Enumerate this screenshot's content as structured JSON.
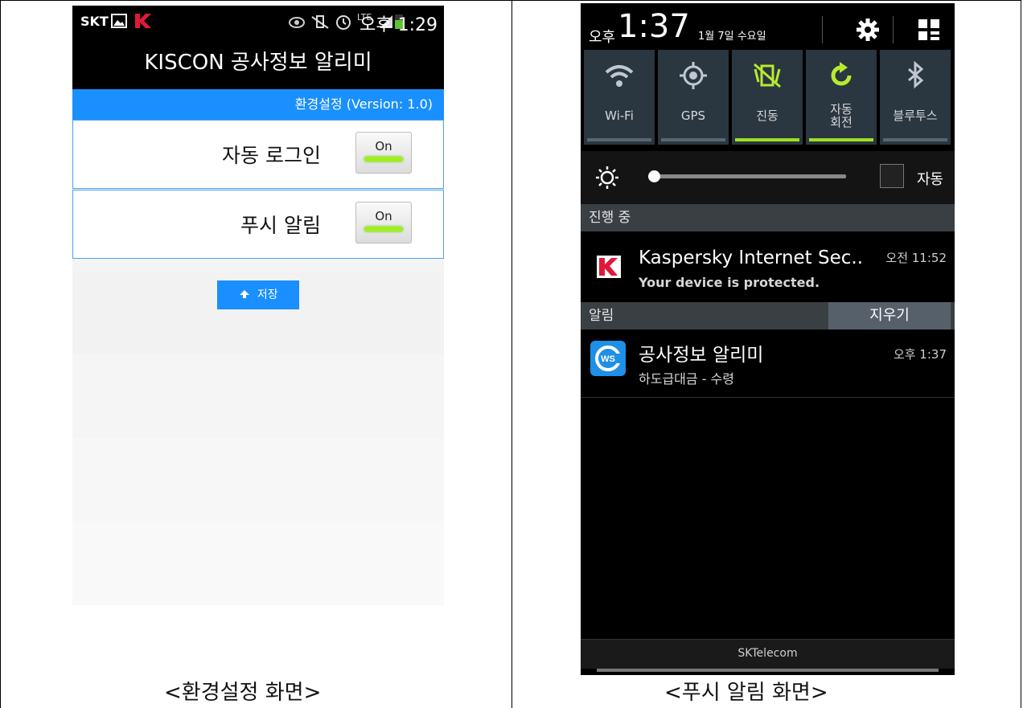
{
  "left_screen": {
    "status_bar": {
      "carrier": "SKT",
      "lte": "LTE",
      "time": "오후 1:29"
    },
    "app_title": "KISCON 공사정보 알리미",
    "version_bar": "환경설정 (Version: 1.0)",
    "settings": [
      {
        "label": "자동 로그인",
        "toggle": "On"
      },
      {
        "label": "푸시 알림",
        "toggle": "On"
      }
    ],
    "save_button": "저장",
    "caption": "<환경설정 화면>"
  },
  "right_screen": {
    "header": {
      "ampm": "오후",
      "time": "1:37",
      "date": "1월 7일 수요일"
    },
    "quick_settings": [
      {
        "label": "Wi-Fi",
        "icon": "wifi-icon",
        "active": false
      },
      {
        "label": "GPS",
        "icon": "gps-icon",
        "active": false
      },
      {
        "label": "진동",
        "icon": "vibrate-icon",
        "active": true
      },
      {
        "label": "자동\n회전",
        "icon": "rotate-icon",
        "active": true
      },
      {
        "label": "블루투스",
        "icon": "bluetooth-icon",
        "active": false
      }
    ],
    "brightness": {
      "auto_label": "자동"
    },
    "ongoing_header": "진행 중",
    "ongoing": {
      "title": "Kaspersky Internet Sec..",
      "subtitle": "Your device is protected.",
      "time": "오전 11:52"
    },
    "notifications_header": "알림",
    "clear_button": "지우기",
    "notification": {
      "title": "공사정보 알리미",
      "subtitle": "하도급대금 - 수령",
      "time": "오후 1:37"
    },
    "carrier": "SKTelecom",
    "caption": "<푸시 알림 화면>"
  }
}
